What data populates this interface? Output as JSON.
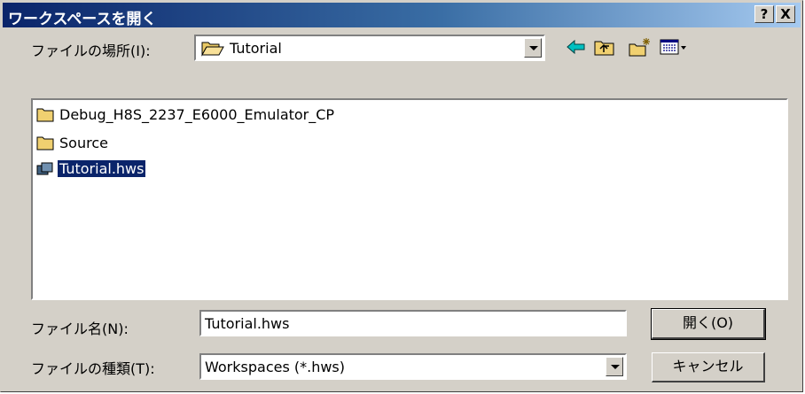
{
  "window": {
    "title": "ワークスペースを開く",
    "help_label": "?",
    "close_label": "X"
  },
  "lookin": {
    "label": "ファイルの場所(I):",
    "value": "Tutorial"
  },
  "toolbar": {
    "back": "back-icon",
    "up": "up-folder-icon",
    "new": "new-folder-icon",
    "view": "view-menu-icon"
  },
  "files": [
    {
      "name": "Debug_H8S_2237_E6000_Emulator_CP",
      "kind": "folder"
    },
    {
      "name": "Source",
      "kind": "folder"
    },
    {
      "name": "Tutorial.hws",
      "kind": "workspace",
      "selected": true
    }
  ],
  "filename": {
    "label": "ファイル名(N):",
    "value": "Tutorial.hws"
  },
  "filetype": {
    "label": "ファイルの種類(T):",
    "value": "Workspaces (*.hws)"
  },
  "buttons": {
    "open": "開く(O)",
    "cancel": "キャンセル"
  }
}
